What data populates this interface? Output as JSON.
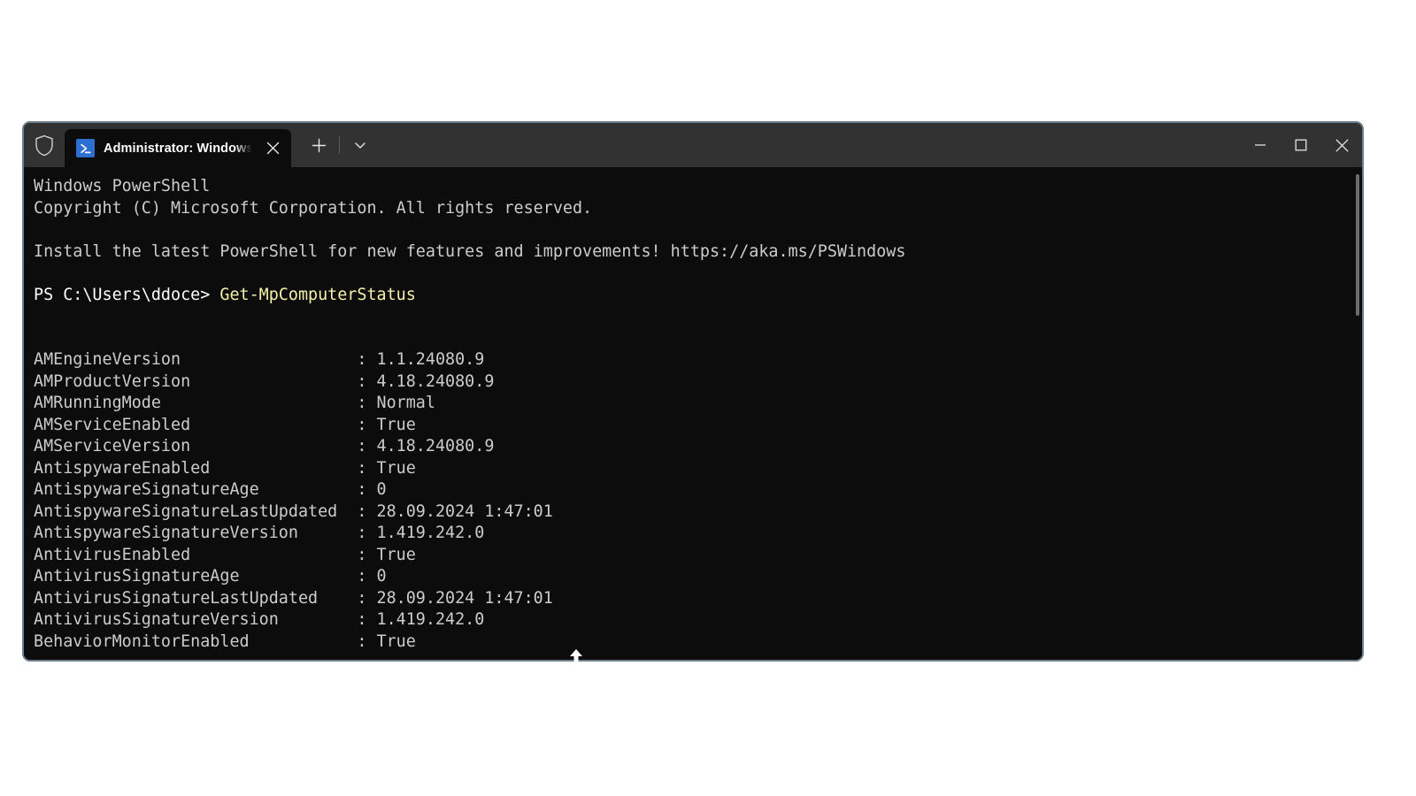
{
  "window": {
    "tab": {
      "title": "Administrator: Windows Powe",
      "icon": "powershell-icon",
      "close_icon": "close-icon"
    },
    "admin_shield_icon": "shield-icon",
    "new_tab_icon": "plus-icon",
    "tab_dropdown_icon": "chevron-down-icon",
    "caption": {
      "minimize_icon": "minimize-icon",
      "maximize_icon": "maximize-icon",
      "close_icon": "close-icon"
    },
    "colors": {
      "titlebar_bg": "#323232",
      "terminal_bg": "#0c0c0c",
      "border": "#6e7f8d",
      "text": "#cccccc",
      "command_text": "#f2f2a8",
      "accent_icon": "#2c6fd1"
    }
  },
  "console": {
    "banner": [
      "Windows PowerShell",
      "Copyright (C) Microsoft Corporation. All rights reserved."
    ],
    "notice": "Install the latest PowerShell for new features and improvements! https://aka.ms/PSWindows",
    "prompt": "PS C:\\Users\\ddoce> ",
    "command": "Get-MpComputerStatus",
    "properties": [
      {
        "name": "AMEngineVersion",
        "value": "1.1.24080.9"
      },
      {
        "name": "AMProductVersion",
        "value": "4.18.24080.9"
      },
      {
        "name": "AMRunningMode",
        "value": "Normal"
      },
      {
        "name": "AMServiceEnabled",
        "value": "True"
      },
      {
        "name": "AMServiceVersion",
        "value": "4.18.24080.9"
      },
      {
        "name": "AntispywareEnabled",
        "value": "True"
      },
      {
        "name": "AntispywareSignatureAge",
        "value": "0"
      },
      {
        "name": "AntispywareSignatureLastUpdated",
        "value": "28.09.2024 1:47:01"
      },
      {
        "name": "AntispywareSignatureVersion",
        "value": "1.419.242.0"
      },
      {
        "name": "AntivirusEnabled",
        "value": "True"
      },
      {
        "name": "AntivirusSignatureAge",
        "value": "0"
      },
      {
        "name": "AntivirusSignatureLastUpdated",
        "value": "28.09.2024 1:47:01"
      },
      {
        "name": "AntivirusSignatureVersion",
        "value": "1.419.242.0"
      },
      {
        "name": "BehaviorMonitorEnabled",
        "value": "True"
      }
    ],
    "property_column_width": 33,
    "separator": ": "
  }
}
